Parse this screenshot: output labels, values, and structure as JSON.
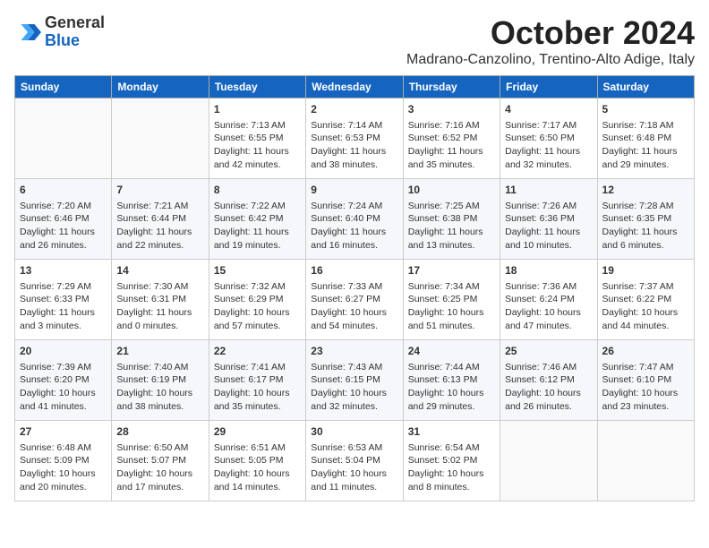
{
  "header": {
    "logo_line1": "General",
    "logo_line2": "Blue",
    "month": "October 2024",
    "location": "Madrano-Canzolino, Trentino-Alto Adige, Italy"
  },
  "weekdays": [
    "Sunday",
    "Monday",
    "Tuesday",
    "Wednesday",
    "Thursday",
    "Friday",
    "Saturday"
  ],
  "weeks": [
    [
      {
        "day": "",
        "info": ""
      },
      {
        "day": "",
        "info": ""
      },
      {
        "day": "1",
        "info": "Sunrise: 7:13 AM\nSunset: 6:55 PM\nDaylight: 11 hours and 42 minutes."
      },
      {
        "day": "2",
        "info": "Sunrise: 7:14 AM\nSunset: 6:53 PM\nDaylight: 11 hours and 38 minutes."
      },
      {
        "day": "3",
        "info": "Sunrise: 7:16 AM\nSunset: 6:52 PM\nDaylight: 11 hours and 35 minutes."
      },
      {
        "day": "4",
        "info": "Sunrise: 7:17 AM\nSunset: 6:50 PM\nDaylight: 11 hours and 32 minutes."
      },
      {
        "day": "5",
        "info": "Sunrise: 7:18 AM\nSunset: 6:48 PM\nDaylight: 11 hours and 29 minutes."
      }
    ],
    [
      {
        "day": "6",
        "info": "Sunrise: 7:20 AM\nSunset: 6:46 PM\nDaylight: 11 hours and 26 minutes."
      },
      {
        "day": "7",
        "info": "Sunrise: 7:21 AM\nSunset: 6:44 PM\nDaylight: 11 hours and 22 minutes."
      },
      {
        "day": "8",
        "info": "Sunrise: 7:22 AM\nSunset: 6:42 PM\nDaylight: 11 hours and 19 minutes."
      },
      {
        "day": "9",
        "info": "Sunrise: 7:24 AM\nSunset: 6:40 PM\nDaylight: 11 hours and 16 minutes."
      },
      {
        "day": "10",
        "info": "Sunrise: 7:25 AM\nSunset: 6:38 PM\nDaylight: 11 hours and 13 minutes."
      },
      {
        "day": "11",
        "info": "Sunrise: 7:26 AM\nSunset: 6:36 PM\nDaylight: 11 hours and 10 minutes."
      },
      {
        "day": "12",
        "info": "Sunrise: 7:28 AM\nSunset: 6:35 PM\nDaylight: 11 hours and 6 minutes."
      }
    ],
    [
      {
        "day": "13",
        "info": "Sunrise: 7:29 AM\nSunset: 6:33 PM\nDaylight: 11 hours and 3 minutes."
      },
      {
        "day": "14",
        "info": "Sunrise: 7:30 AM\nSunset: 6:31 PM\nDaylight: 11 hours and 0 minutes."
      },
      {
        "day": "15",
        "info": "Sunrise: 7:32 AM\nSunset: 6:29 PM\nDaylight: 10 hours and 57 minutes."
      },
      {
        "day": "16",
        "info": "Sunrise: 7:33 AM\nSunset: 6:27 PM\nDaylight: 10 hours and 54 minutes."
      },
      {
        "day": "17",
        "info": "Sunrise: 7:34 AM\nSunset: 6:25 PM\nDaylight: 10 hours and 51 minutes."
      },
      {
        "day": "18",
        "info": "Sunrise: 7:36 AM\nSunset: 6:24 PM\nDaylight: 10 hours and 47 minutes."
      },
      {
        "day": "19",
        "info": "Sunrise: 7:37 AM\nSunset: 6:22 PM\nDaylight: 10 hours and 44 minutes."
      }
    ],
    [
      {
        "day": "20",
        "info": "Sunrise: 7:39 AM\nSunset: 6:20 PM\nDaylight: 10 hours and 41 minutes."
      },
      {
        "day": "21",
        "info": "Sunrise: 7:40 AM\nSunset: 6:19 PM\nDaylight: 10 hours and 38 minutes."
      },
      {
        "day": "22",
        "info": "Sunrise: 7:41 AM\nSunset: 6:17 PM\nDaylight: 10 hours and 35 minutes."
      },
      {
        "day": "23",
        "info": "Sunrise: 7:43 AM\nSunset: 6:15 PM\nDaylight: 10 hours and 32 minutes."
      },
      {
        "day": "24",
        "info": "Sunrise: 7:44 AM\nSunset: 6:13 PM\nDaylight: 10 hours and 29 minutes."
      },
      {
        "day": "25",
        "info": "Sunrise: 7:46 AM\nSunset: 6:12 PM\nDaylight: 10 hours and 26 minutes."
      },
      {
        "day": "26",
        "info": "Sunrise: 7:47 AM\nSunset: 6:10 PM\nDaylight: 10 hours and 23 minutes."
      }
    ],
    [
      {
        "day": "27",
        "info": "Sunrise: 6:48 AM\nSunset: 5:09 PM\nDaylight: 10 hours and 20 minutes."
      },
      {
        "day": "28",
        "info": "Sunrise: 6:50 AM\nSunset: 5:07 PM\nDaylight: 10 hours and 17 minutes."
      },
      {
        "day": "29",
        "info": "Sunrise: 6:51 AM\nSunset: 5:05 PM\nDaylight: 10 hours and 14 minutes."
      },
      {
        "day": "30",
        "info": "Sunrise: 6:53 AM\nSunset: 5:04 PM\nDaylight: 10 hours and 11 minutes."
      },
      {
        "day": "31",
        "info": "Sunrise: 6:54 AM\nSunset: 5:02 PM\nDaylight: 10 hours and 8 minutes."
      },
      {
        "day": "",
        "info": ""
      },
      {
        "day": "",
        "info": ""
      }
    ]
  ]
}
